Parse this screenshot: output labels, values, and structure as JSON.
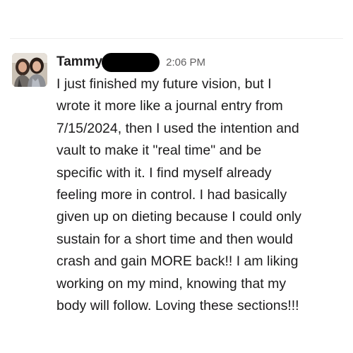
{
  "message": {
    "sender": "Tammy",
    "timestamp": "2:06 PM",
    "body_lines": [
      "I just finished my future vision, but I",
      "wrote it more like a journal entry from",
      "7/15/2024, then I used the intention and",
      "vault to make it \"real time\" and be",
      "specific with it. I find myself already",
      "feeling more in control. I had basically",
      "given up on dieting because I could only",
      "sustain for a short time and then would",
      "crash and gain MORE back!! I am liking",
      "working on my mind, knowing that my",
      "body will follow. Loving these sections!!!"
    ]
  },
  "icons": {
    "avatar": "user-avatar-photo",
    "redaction": "redaction-bar"
  }
}
